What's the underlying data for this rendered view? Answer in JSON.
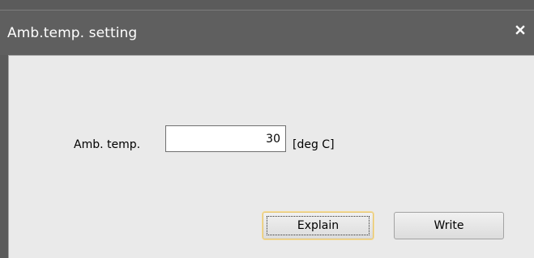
{
  "window": {
    "title": "Amb.temp. setting"
  },
  "form": {
    "amb_temp_label": "Amb. temp.",
    "amb_temp_value": "30",
    "unit_label": "[deg C]"
  },
  "buttons": {
    "explain_label": "Explain",
    "write_label": "Write"
  },
  "icons": {
    "close": "close-icon"
  },
  "colors": {
    "titlebar": "#5f5f5f",
    "client_background": "#eaeaea",
    "focus_highlight": "#e8c66e"
  }
}
